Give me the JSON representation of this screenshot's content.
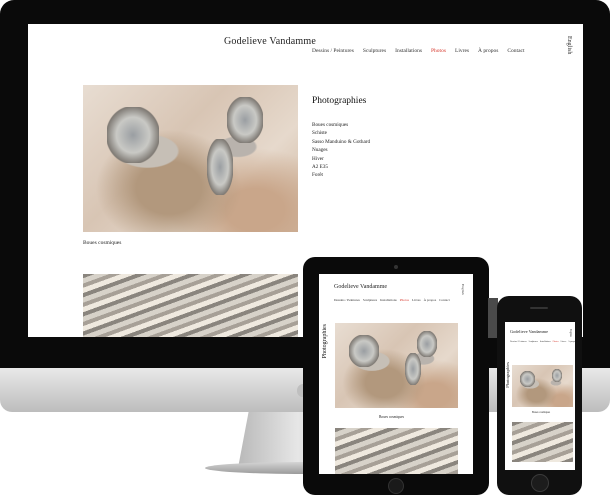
{
  "site": {
    "title": "Godelieve Vandamme",
    "nav": [
      "Dessins / Peintures",
      "Sculptures",
      "Installations",
      "Photos",
      "Livres",
      "À propos",
      "Contact"
    ],
    "nav_active": "Photos",
    "language": "English"
  },
  "page": {
    "heading": "Photographies",
    "items": [
      "Boues cosmiques",
      "Schiste",
      "Sasso Manduino & Gothard",
      "Nuages",
      "Hiver",
      "A2 E35",
      "Forêt"
    ],
    "caption": "Boues cosmiques"
  },
  "colors": {
    "active": "#d6372c",
    "text": "#222222",
    "device": "#0a0a0a"
  }
}
